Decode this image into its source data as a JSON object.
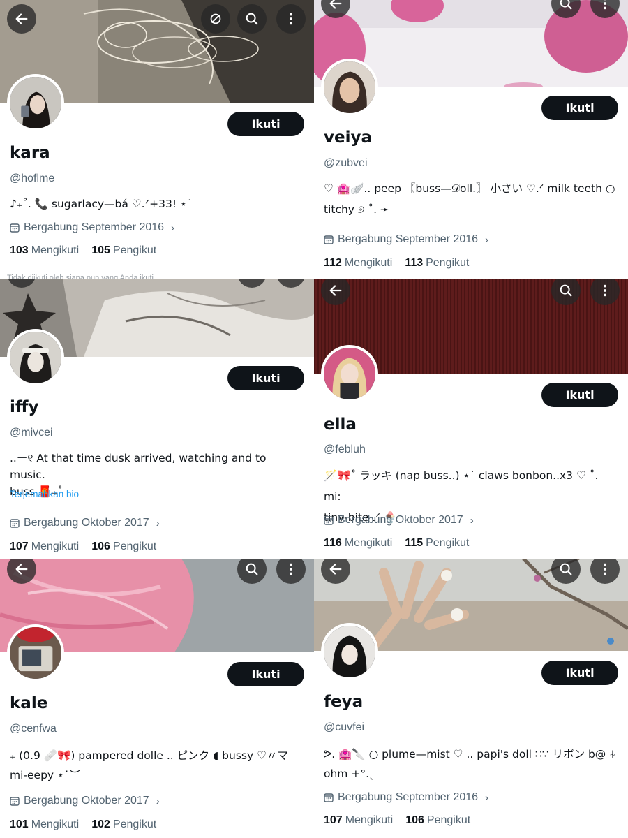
{
  "ui": {
    "follow_label": "Ikuti"
  },
  "profiles": [
    {
      "name": "kara",
      "handle": "@hoflme",
      "bio": "♪₊˚. 📞 sugarlacy—bá ♡.ᐟ+33! ⋆˙",
      "joined": "Bergabung September 2016",
      "following": "103",
      "followers": "105",
      "following_label": "Mengikuti",
      "followers_label": "Pengikut",
      "peek_text": "Tidak diikuti oleh siapa pun yang Anda ikuti"
    },
    {
      "name": "veiya",
      "handle": "@zubvei",
      "bio_line1": "♡ 🏩🪽.. peep 〖buss—𝒟oll.〗 小さい ♡.ᐟ milk teeth ○",
      "bio_line2": "titchy ୭ ˚. ➛",
      "joined": "Bergabung September 2016",
      "following": "112",
      "followers": "113",
      "following_label": "Mengikuti",
      "followers_label": "Pengikut"
    },
    {
      "name": "iffy",
      "handle": "@mivcei",
      "bio_line1": "..ー୧ At that time dusk arrived, watching and to music.",
      "bio_line2": "buss 🧧₊˚",
      "translate": "Terjemahkan bio",
      "joined": "Bergabung Oktober 2017",
      "following": "107",
      "followers": "106",
      "following_label": "Mengikuti",
      "followers_label": "Pengikut"
    },
    {
      "name": "ella",
      "handle": "@febluh",
      "bio_line1": "🪄🎀˚ ラッキ (nap buss..) ⋆˙ claws bonbon..x3 ♡ ˚. mi:",
      "bio_line2": "tiny-bite .ᐟ 🍨",
      "joined": "Bergabung Oktober 2017",
      "following": "116",
      "followers": "115",
      "following_label": "Mengikuti",
      "followers_label": "Pengikut"
    },
    {
      "name": "kale",
      "handle": "@cenfwa",
      "bio_line1": "₊ (0.9 🩹🎀) pampered dolle .. ピンク ◖ bussy ♡〃マ",
      "bio_line2": "mi-eepy ⋆˙︶",
      "joined": "Bergabung Oktober 2017",
      "following": "101",
      "followers": "102",
      "following_label": "Mengikuti",
      "followers_label": "Pengikut"
    },
    {
      "name": "feya",
      "handle": "@cuvfei",
      "bio_line1": "ᕗ. 🏩🔪 ○ plume—mist ♡ .. papi's doll ∷∵ リボン b@ ⍭",
      "bio_line2": "ohm +°.ˎ",
      "joined": "Bergabung September 2016",
      "following": "107",
      "followers": "106",
      "following_label": "Mengikuti",
      "followers_label": "Pengikut"
    }
  ],
  "icons": [
    "back-arrow-icon",
    "retweet-off-icon",
    "search-icon",
    "more-vertical-icon",
    "calendar-icon",
    "chevron-right-icon"
  ],
  "colors": {
    "follow_button": "#0f1419",
    "secondary_text": "#536471",
    "link": "#1d9bf0"
  }
}
